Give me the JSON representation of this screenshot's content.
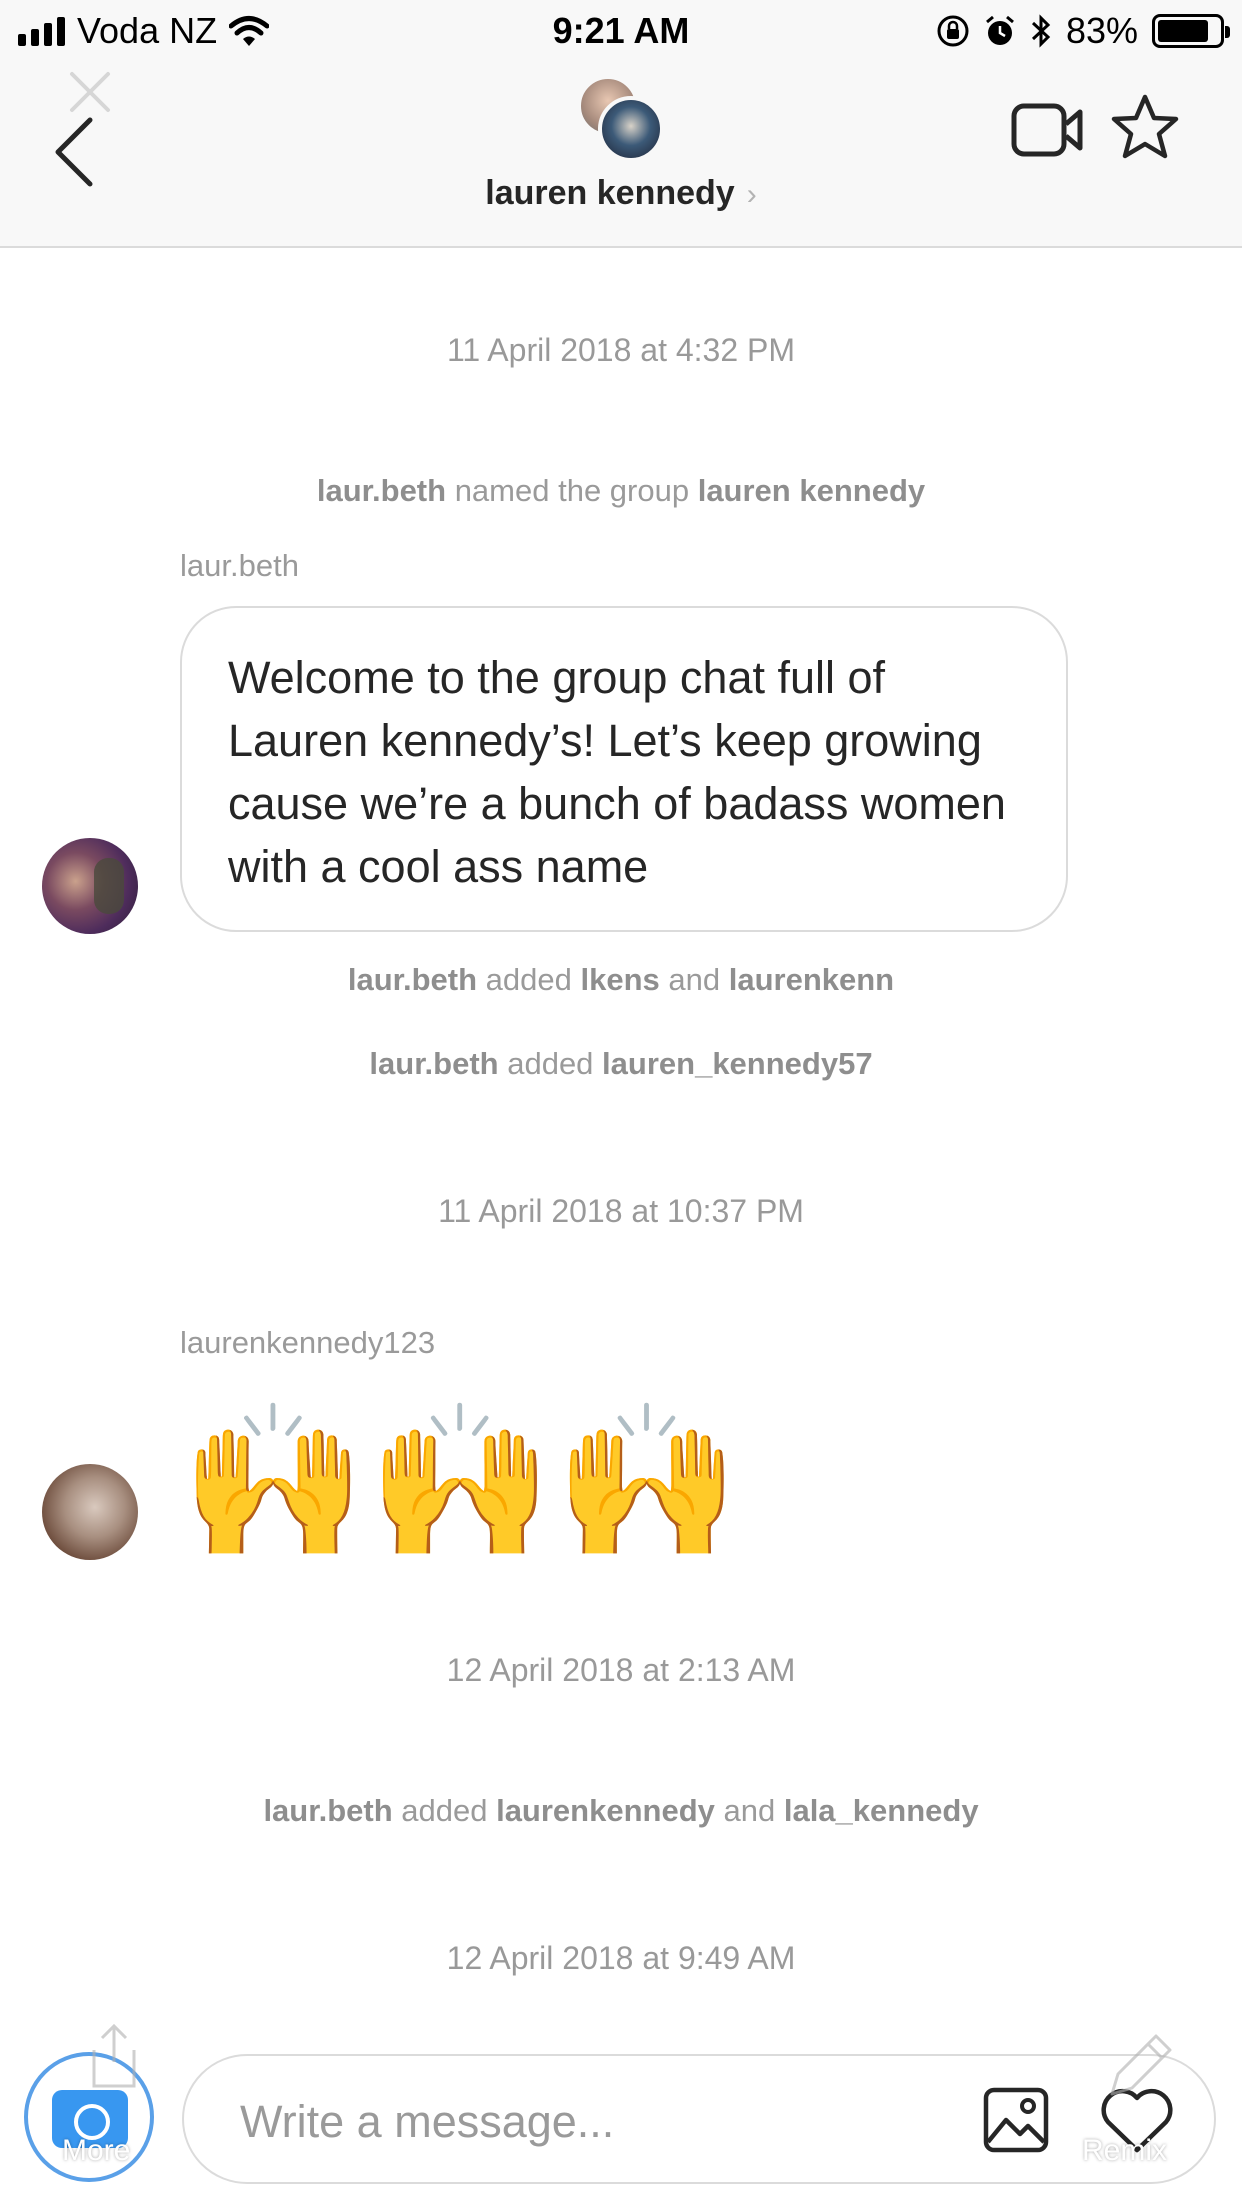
{
  "status_bar": {
    "carrier": "Voda NZ",
    "time": "9:21 AM",
    "battery": "83%",
    "battery_level": 0.83,
    "icons": [
      "signal-icon",
      "wifi-icon",
      "rotation-lock-icon",
      "alarm-icon",
      "bluetooth-icon",
      "battery-icon"
    ]
  },
  "header": {
    "title": "lauren kennedy",
    "chevron": "›",
    "icons": [
      "back-arrow-icon",
      "video-call-icon",
      "star-icon"
    ]
  },
  "conversation": {
    "timestamp_1": "11 April 2018 at 4:32 PM",
    "event_1": {
      "actor": "laur.beth",
      "action": " named the group ",
      "target": "lauren kennedy"
    },
    "message_1": {
      "sender": "laur.beth",
      "text": "Welcome to the group chat full of Lauren kennedy’s! Let’s keep growing cause we’re a bunch of badass women with a cool ass name"
    },
    "event_2": {
      "actor": "laur.beth",
      "action": " added ",
      "target1": "lkens",
      "conj": " and ",
      "target2": "laurenkenn"
    },
    "event_3": {
      "actor": "laur.beth",
      "action": " added ",
      "target": "lauren_kennedy57"
    },
    "timestamp_2": "11 April 2018 at 10:37 PM",
    "message_2": {
      "sender": "laurenkennedy123",
      "emojis": [
        "🙌",
        "🙌",
        "🙌"
      ]
    },
    "timestamp_3": "12 April 2018 at 2:13 AM",
    "event_4": {
      "actor": "laur.beth",
      "action": " added ",
      "target1": "laurenkennedy",
      "conj": " and ",
      "target2": "lala_kennedy"
    },
    "timestamp_4": "12 April 2018 at 9:49 AM"
  },
  "composer": {
    "placeholder": "Write a message...",
    "more_label": "More",
    "remix_label": "Remix",
    "icons": [
      "camera-icon",
      "gallery-icon",
      "heart-icon"
    ]
  },
  "colors": {
    "accent": "#3897f0",
    "text": "#262626",
    "muted": "#999999",
    "border": "#dbdbdb"
  }
}
